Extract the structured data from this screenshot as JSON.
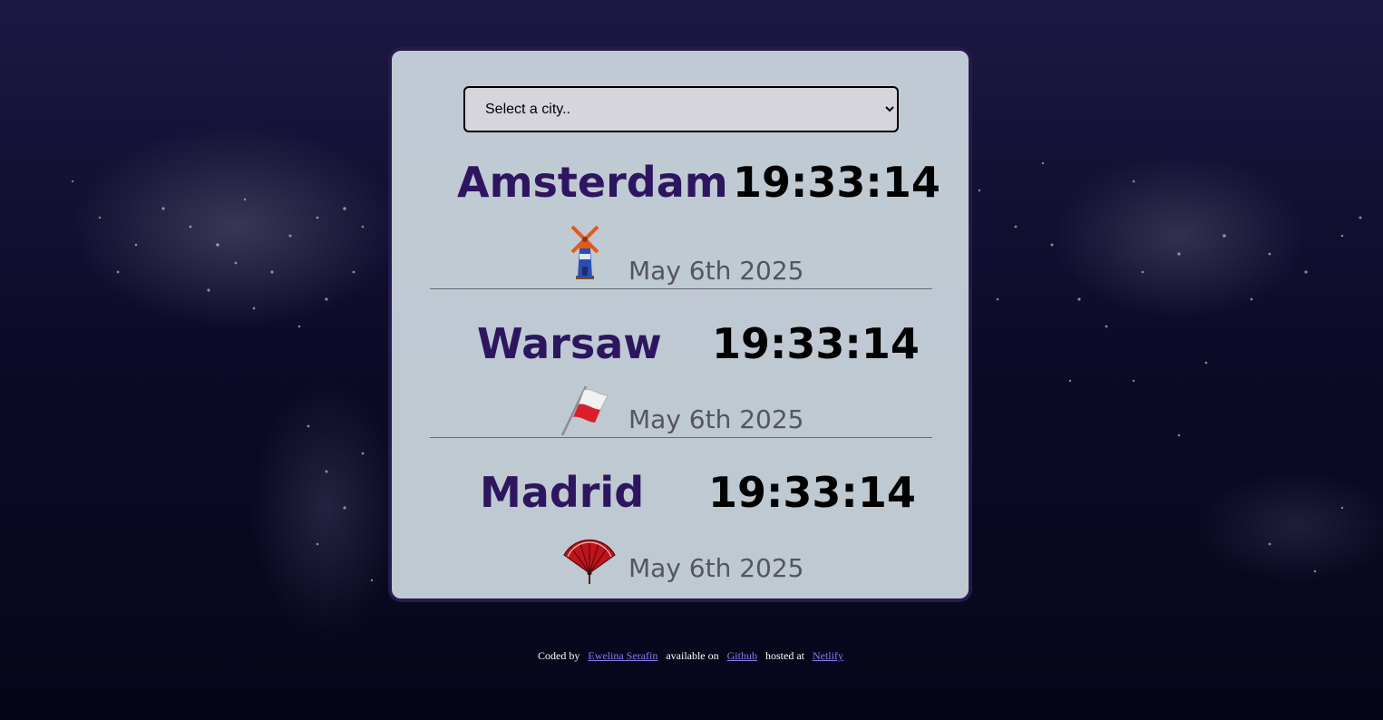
{
  "select": {
    "selected": "Select a city.."
  },
  "cities": [
    {
      "name": "Amsterdam",
      "time": "19:33:14",
      "date": "May 6th 2025",
      "icon": "windmill-icon"
    },
    {
      "name": "Warsaw",
      "time": "19:33:14",
      "date": "May 6th 2025",
      "icon": "poland-flag-icon"
    },
    {
      "name": "Madrid",
      "time": "19:33:14",
      "date": "May 6th 2025",
      "icon": "fan-icon"
    }
  ],
  "footer": {
    "coded_by": "Coded by",
    "author": "Ewelina Serafin",
    "available_on": "available on",
    "github": "Github",
    "hosted_at": "hosted at",
    "netlify": "Netlify"
  },
  "colors": {
    "city_name": "#2d165f",
    "card_border": "#261a4a",
    "link": "#8a7cf0"
  }
}
